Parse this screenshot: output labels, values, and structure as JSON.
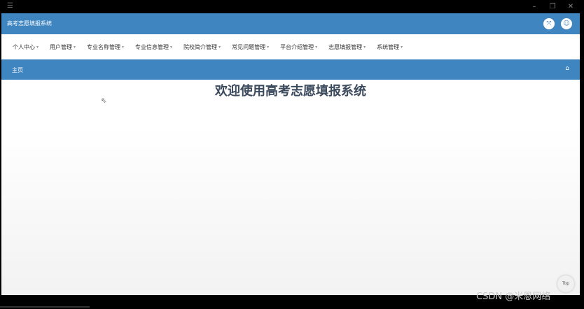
{
  "app": {
    "title": "高考志愿填报系统"
  },
  "nav": {
    "items": [
      {
        "label": "个人中心"
      },
      {
        "label": "用户管理"
      },
      {
        "label": "专业名称管理"
      },
      {
        "label": "专业信息管理"
      },
      {
        "label": "院校简介管理"
      },
      {
        "label": "常见问题管理"
      },
      {
        "label": "平台介绍管理"
      },
      {
        "label": "志愿填报管理"
      },
      {
        "label": "系统管理"
      }
    ]
  },
  "breadcrumb": {
    "label": "主页"
  },
  "main": {
    "welcome": "欢迎使用高考志愿填报系统"
  },
  "controls": {
    "top_label": "Top"
  },
  "watermark": {
    "text": "CSDN @米恩网络"
  },
  "icons": {
    "fullscreen": "fullscreen-icon",
    "user": "user-icon",
    "home": "home-icon"
  },
  "colors": {
    "primary": "#3f85c0",
    "heading": "#3c4a5d"
  }
}
